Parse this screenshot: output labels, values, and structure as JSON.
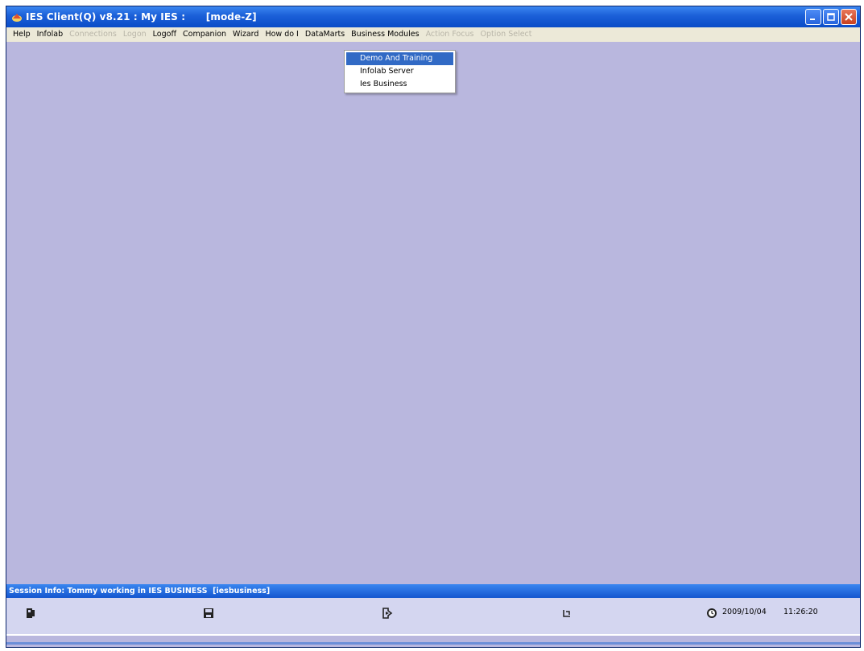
{
  "window": {
    "title": "IES Client(Q) v8.21 : My IES :      [mode-Z]"
  },
  "menubar": {
    "items": [
      {
        "label": "Help",
        "enabled": true
      },
      {
        "label": "Infolab",
        "enabled": true
      },
      {
        "label": "Connections",
        "enabled": false
      },
      {
        "label": "Logon",
        "enabled": false
      },
      {
        "label": "Logoff",
        "enabled": true
      },
      {
        "label": "Companion",
        "enabled": true
      },
      {
        "label": "Wizard",
        "enabled": true
      },
      {
        "label": "How do I",
        "enabled": true
      },
      {
        "label": "DataMarts",
        "enabled": true
      },
      {
        "label": "Business Modules",
        "enabled": true
      },
      {
        "label": "Action Focus",
        "enabled": false
      },
      {
        "label": "Option Select",
        "enabled": false
      }
    ]
  },
  "dropdown": {
    "items": [
      {
        "label": "Demo And Training",
        "selected": true
      },
      {
        "label": "Infolab Server",
        "selected": false
      },
      {
        "label": "Ies Business",
        "selected": false
      }
    ]
  },
  "session": {
    "info": "Session Info: Tommy working in IES BUSINESS  [iesbusiness]"
  },
  "statusbar": {
    "date": "2009/10/04",
    "time": "11:26:20"
  },
  "toolbar_icons": [
    "phone-icon",
    "save-icon",
    "next-icon",
    "fetch-icon",
    "clock-icon"
  ],
  "colors": {
    "workspace": "#b9b7de",
    "titlebar": "#1b5fd8",
    "menubar": "#ece9d8",
    "selection": "#316ac5",
    "toolbar": "#d4d6f0"
  }
}
